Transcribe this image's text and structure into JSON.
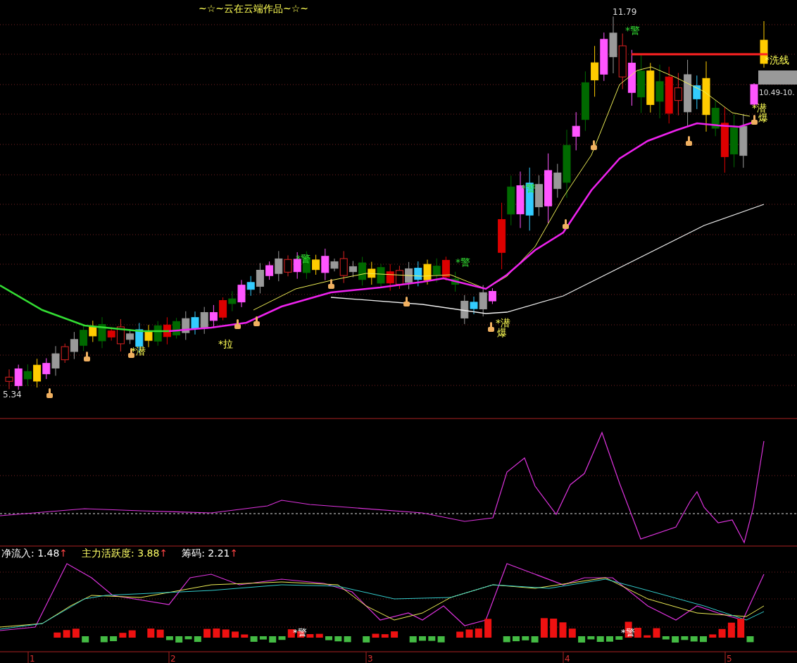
{
  "title": "~☆~云在云端作品~☆~",
  "price_labels": [
    {
      "kind": "high",
      "text": "11.79"
    },
    {
      "kind": "low",
      "text": "5.34"
    },
    {
      "kind": "last",
      "text": "10.49-10."
    }
  ],
  "signals": [
    {
      "kind": "warn",
      "text": "*警"
    },
    {
      "kind": "warn",
      "text": "*警"
    },
    {
      "kind": "warn",
      "text": "*警"
    },
    {
      "kind": "warn",
      "text": "*警"
    },
    {
      "kind": "tip",
      "text": "*潜"
    },
    {
      "kind": "tip",
      "text": "*拉"
    },
    {
      "kind": "tip",
      "text": "*潜"
    },
    {
      "kind": "tip",
      "text": "爆"
    },
    {
      "kind": "tip",
      "text": "*潜"
    },
    {
      "kind": "tip",
      "text": "爆"
    },
    {
      "kind": "tip",
      "text": "*洗线"
    }
  ],
  "indicator_header": [
    {
      "label": "净流入:",
      "value": "1.48",
      "arrow": "↑",
      "color": "#ffffff"
    },
    {
      "label": "主力活跃度:",
      "value": "3.88",
      "arrow": "↑",
      "color": "#ffff66"
    },
    {
      "label": "筹码:",
      "value": "2.21",
      "arrow": "↑",
      "color": "#ffffff"
    }
  ],
  "volume_signals": [
    {
      "text": "*警"
    },
    {
      "text": "*警"
    }
  ],
  "time_axis": [
    "1",
    "2",
    "3",
    "4",
    "5"
  ]
}
